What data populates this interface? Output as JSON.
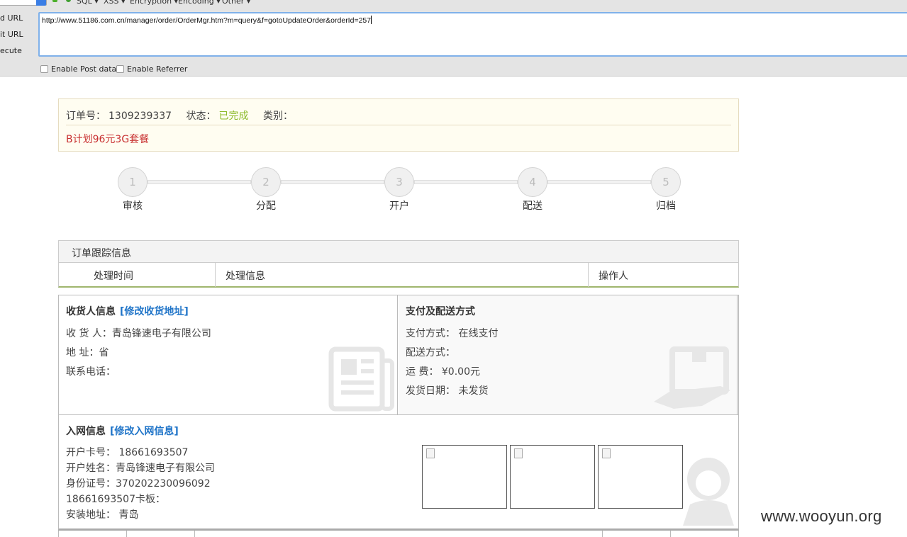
{
  "hackbar": {
    "menus": [
      "SQL",
      "XSS",
      "Encryption",
      "Encoding",
      "Other"
    ],
    "side_labels": [
      "d URL",
      "it URL",
      "ecute"
    ],
    "url_value": "http://www.51186.com.cn/manager/order/OrderMgr.htm?m=query&f=gotoUpdateOrder&orderId=257",
    "checkbox_post": "Enable Post data",
    "checkbox_referrer": "Enable Referrer"
  },
  "order": {
    "number_label": "订单号：",
    "number_value": "1309239337",
    "status_label": "状态：",
    "status_value": "已完成",
    "category_label": "类别：",
    "plan": "B计划96元3G套餐",
    "status_color": "#8cba2a",
    "plan_color": "#c82f2f"
  },
  "steps": [
    {
      "num": "1",
      "label": "审核"
    },
    {
      "num": "2",
      "label": "分配"
    },
    {
      "num": "3",
      "label": "开户"
    },
    {
      "num": "4",
      "label": "配送"
    },
    {
      "num": "5",
      "label": "归档"
    }
  ],
  "tracking": {
    "title": "订单跟踪信息",
    "columns": [
      "处理时间",
      "处理信息",
      "操作人"
    ]
  },
  "consignee": {
    "title": "收货人信息",
    "edit_link": "[修改收货地址]",
    "rows": [
      "收  货  人：青岛锋速电子有限公司",
      "地      址：省",
      "联系电话："
    ]
  },
  "payment": {
    "title": "支付及配送方式",
    "rows": [
      "支付方式： 在线支付",
      "配送方式：",
      "运      费： ¥0.00元",
      "发货日期： 未发货"
    ]
  },
  "network": {
    "title": "入网信息",
    "edit_link": "[修改入网信息]",
    "rows": [
      "开户卡号： 18661693507",
      "开户姓名：青岛锋速电子有限公司",
      "身份证号：370202230096092",
      "18661693507卡板：",
      "安装地址： 青岛"
    ]
  },
  "watermark": "www.wooyun.org"
}
